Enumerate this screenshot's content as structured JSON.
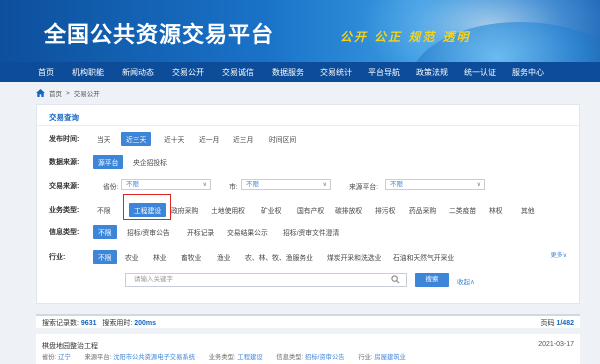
{
  "banner": {
    "title": "全国公共资源交易平台",
    "slogan": "公开 公正 规范 透明"
  },
  "nav": [
    "首页",
    "机构职能",
    "新闻动态",
    "交易公开",
    "交易诚信",
    "数据服务",
    "交易统计",
    "平台导航",
    "政策法规",
    "统一认证",
    "服务中心"
  ],
  "breadcrumb": {
    "home": "首页",
    "separator": ">",
    "current": "交易公开"
  },
  "panel": {
    "title": "交易查询",
    "publish_time": {
      "label": "发布时间:",
      "options": [
        "当天",
        "近三天",
        "近十天",
        "近一月",
        "近三月",
        "时间区间"
      ],
      "selected": "近三天"
    },
    "data_source": {
      "label": "数据来源:",
      "options": [
        "源平台",
        "央企招投标"
      ],
      "selected": "源平台"
    },
    "trade_source": {
      "label": "交易来源:",
      "province_label": "省份:",
      "province_value": "不限",
      "city_label": "市:",
      "city_value": "不限",
      "platform_label": "来源平台:",
      "platform_value": "不限"
    },
    "business_type": {
      "label": "业务类型:",
      "options": [
        "不限",
        "工程建设",
        "政府采购",
        "土地使用权",
        "矿业权",
        "国有产权",
        "碳排放权",
        "排污权",
        "药品采购",
        "二类疫苗",
        "林权",
        "其他"
      ],
      "selected": "工程建设"
    },
    "info_type": {
      "label": "信息类型:",
      "options": [
        "不限",
        "招标/资审公告",
        "开标记录",
        "交易结果公示",
        "招标/资审文件澄清"
      ],
      "selected": "不限"
    },
    "industry": {
      "label": "行业:",
      "options": [
        "不限",
        "农业",
        "林业",
        "畜牧业",
        "渔业",
        "农、林、牧、渔服务业",
        "煤炭开采和洗选业",
        "石油和天然气开采业"
      ],
      "selected": "不限",
      "more": "更多∨"
    },
    "search_placeholder": "请输入关键字",
    "search_button": "搜索",
    "collapse": "收起∧"
  },
  "results": {
    "count_label": "搜索记录数:",
    "count": "9631",
    "time_label": "搜索用时:",
    "time": "200ms",
    "page_label": "页码",
    "page": "1/482"
  },
  "record": {
    "title": "棋盘地园整治工程",
    "date": "2021-03-17",
    "province_label": "省份:",
    "province": "辽宁",
    "platform_label": "来源平台:",
    "platform": "沈阳市公共资源电子交易系统",
    "btype_label": "业务类型:",
    "btype": "工程建设",
    "itype_label": "信息类型:",
    "itype": "招标/资审公告",
    "industry_label": "行业:",
    "industry": "房屋建筑业"
  },
  "colors": {
    "accent": "#3c85d8",
    "nav_bg": "#0c4c98",
    "highlight_box": "#e32222",
    "slogan": "#f5d31b"
  }
}
